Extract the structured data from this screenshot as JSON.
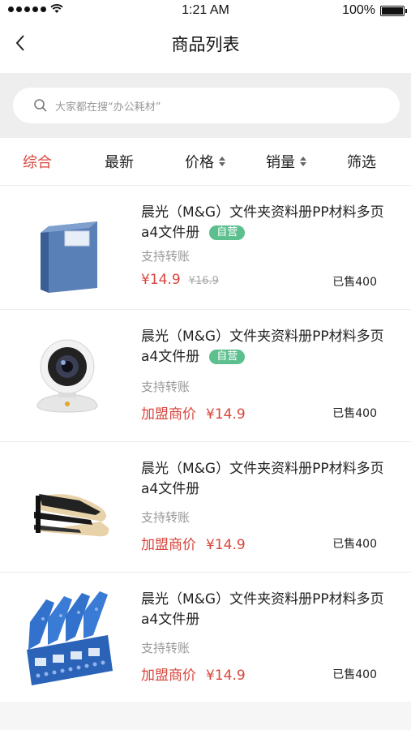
{
  "status_bar": {
    "time": "1:21 AM",
    "battery": "100%"
  },
  "nav": {
    "title": "商品列表"
  },
  "search": {
    "placeholder": "大家都在搜“办公耗材”"
  },
  "filters": [
    {
      "label": "综合",
      "active": true,
      "sortable": false
    },
    {
      "label": "最新",
      "active": false,
      "sortable": false
    },
    {
      "label": "价格",
      "active": false,
      "sortable": true
    },
    {
      "label": "销量",
      "active": false,
      "sortable": true
    },
    {
      "label": "筛选",
      "active": false,
      "sortable": false
    }
  ],
  "products": [
    {
      "title": "晨光（M&G）文件夹资料册PP材料多页a4文件册",
      "badge": "自营",
      "transfer": "支持转账",
      "price_label": "",
      "price": "¥14.9",
      "original_price": "¥16.9",
      "sold": "已售400",
      "image": "blue-folder-box"
    },
    {
      "title": "晨光（M&G）文件夹资料册PP材料多页a4文件册",
      "badge": "自营",
      "transfer": "支持转账",
      "price_label": "加盟商价",
      "price": "¥14.9",
      "original_price": "",
      "sold": "已售400",
      "image": "security-camera"
    },
    {
      "title": "晨光（M&G）文件夹资料册PP材料多页a4文件册",
      "badge": "",
      "transfer": "支持转账",
      "price_label": "加盟商价",
      "price": "¥14.9",
      "original_price": "",
      "sold": "已售400",
      "image": "stapler"
    },
    {
      "title": "晨光（M&G）文件夹资料册PP材料多页a4文件册",
      "badge": "",
      "transfer": "支持转账",
      "price_label": "加盟商价",
      "price": "¥14.9",
      "original_price": "",
      "sold": "已售400",
      "image": "file-rack"
    }
  ],
  "colors": {
    "accent": "#d9463c",
    "badge": "#5bbf8e"
  }
}
